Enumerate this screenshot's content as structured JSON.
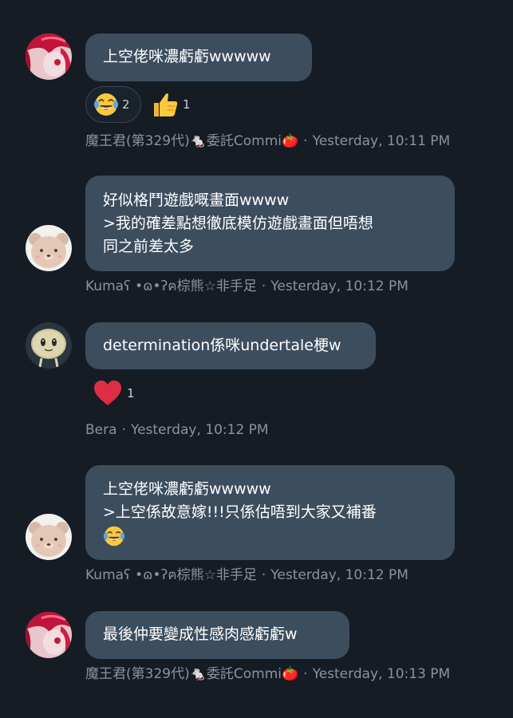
{
  "messages": [
    {
      "author": "魔王君(第329代)🐁委託Commi🍅",
      "time": "Yesterday, 10:11 PM",
      "lines": [
        "上空佬咪濃虧虧wwwww"
      ],
      "reactions": [
        {
          "icon": "face-with-tears-of-joy-icon",
          "count": "2"
        },
        {
          "icon": "thumbs-up-icon",
          "count": "1"
        }
      ]
    },
    {
      "author": "Kumaʕ •ɷ•ʔฅ棕熊☆非手足",
      "time": "Yesterday, 10:12 PM",
      "lines": [
        "好似格鬥遊戲嘅畫面wwww",
        ">我的確差點想徹底模仿遊戲畫面但唔想",
        "同之前差太多"
      ]
    },
    {
      "author": "Bera",
      "time": "Yesterday, 10:12 PM",
      "lines": [
        "determination係咪undertale梗w"
      ],
      "reactions": [
        {
          "icon": "red-heart-icon",
          "count": "1"
        }
      ]
    },
    {
      "author": "Kumaʕ •ɷ•ʔฅ棕熊☆非手足",
      "time": "Yesterday, 10:12 PM",
      "lines": [
        "上空佬咪濃虧虧wwwww",
        ">上空係故意嫁!!!只係估唔到大家又補番"
      ],
      "trailing_emoji": "face-with-tears-of-joy-icon"
    },
    {
      "author": "魔王君(第329代)🐁委託Commi🍅",
      "time": "Yesterday, 10:13 PM",
      "lines": [
        "最後仲要變成性感肉感虧虧w"
      ]
    }
  ],
  "colors": {
    "background": "#151c24",
    "bubble": "#3c4d5e",
    "meta_text": "#8a939d",
    "heart": "#dd2e44"
  }
}
